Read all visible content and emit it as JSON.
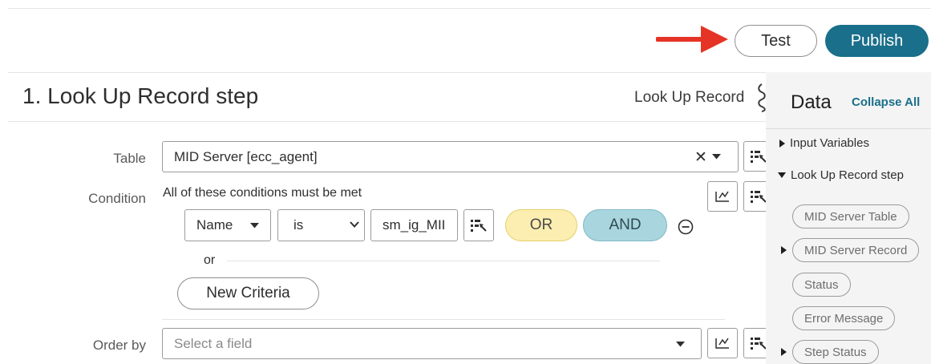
{
  "toolbar": {
    "test_label": "Test",
    "publish_label": "Publish",
    "publish_color": "#1a6f8a"
  },
  "step": {
    "title": "1.  Look Up Record step",
    "type_label": "Look Up Record"
  },
  "form": {
    "table": {
      "label": "Table",
      "value": "MID Server [ecc_agent]",
      "clear_icon": "✕",
      "icon": "data-pill-picker-icon"
    },
    "condition": {
      "label": "Condition",
      "description": "All of these conditions must be met",
      "field": "Name",
      "operator": "is",
      "value": "sm_ig_MII",
      "or_button": "OR",
      "and_button": "AND",
      "or_separator": "or",
      "new_criteria": "New Criteria"
    },
    "order_by": {
      "label": "Order by",
      "placeholder": "Select a field"
    }
  },
  "data_panel": {
    "title": "Data",
    "collapse_all": "Collapse All",
    "sections": [
      {
        "label": "Input Variables",
        "expanded": false
      },
      {
        "label": "Look Up Record step",
        "expanded": true
      }
    ],
    "pills": [
      {
        "label": "MID Server Table",
        "expandable": false
      },
      {
        "label": "MID Server Record",
        "expandable": true
      },
      {
        "label": "Status",
        "expandable": false
      },
      {
        "label": "Error Message",
        "expandable": false
      },
      {
        "label": "Step Status",
        "expandable": true
      }
    ]
  }
}
